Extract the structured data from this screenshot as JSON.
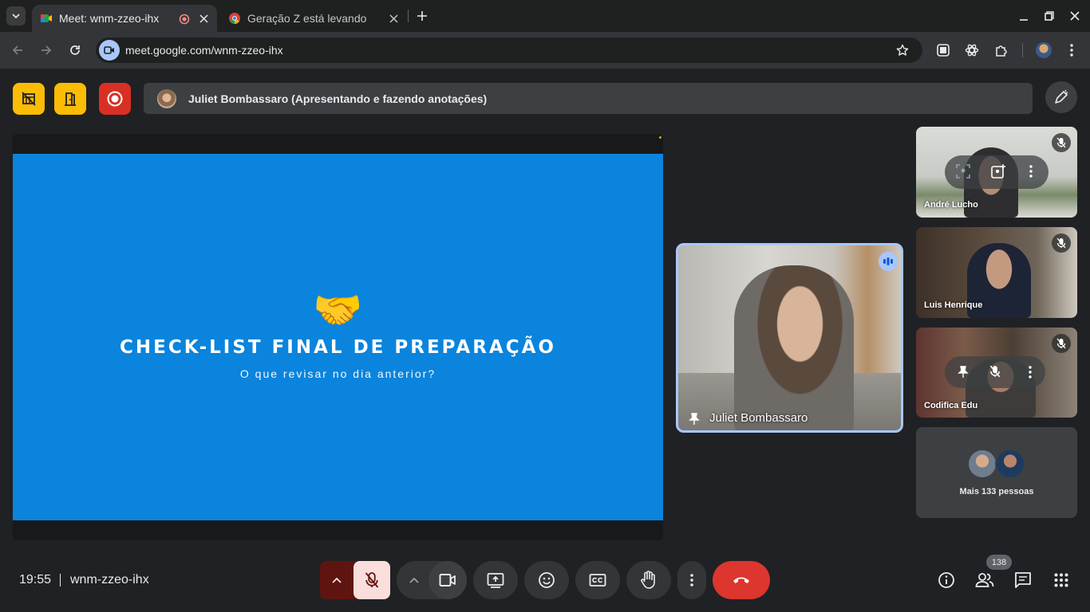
{
  "browser": {
    "tabs": [
      {
        "title": "Meet: wnm-zzeo-ihx",
        "active": true,
        "recording": true
      },
      {
        "title": "Geração Z está levando",
        "active": false
      }
    ],
    "url": "meet.google.com/wnm-zzeo-ihx"
  },
  "meeting": {
    "presenter_banner": "Juliet Bombassaro (Apresentando e fazendo anotações)",
    "slide": {
      "emoji": "🤝",
      "title": "CHECK-LIST FINAL DE PREPARAÇÃO",
      "subtitle": "O que revisar no dia anterior?"
    },
    "featured": {
      "name": "Juliet Bombassaro"
    },
    "participants": [
      {
        "name": "André Lucho",
        "muted": true
      },
      {
        "name": "Luis Henrique",
        "muted": true
      },
      {
        "name": "Codifica Edu",
        "muted": true
      }
    ],
    "more_people": "Mais 133 pessoas",
    "clock": "19:55",
    "code": "wnm-zzeo-ihx",
    "people_count": "138"
  },
  "colors": {
    "accent_yellow": "#fbbc04",
    "record_red": "#d93025",
    "slide_blue": "#0a84dc",
    "hangup_red": "#dc362e",
    "mic_off_bg": "#f9dedc",
    "speaker_border": "#a8c7fa"
  },
  "icons": [
    "dropdown-icon",
    "meet-icon",
    "record-dot-icon",
    "chrome-icon",
    "close-icon",
    "plus-icon",
    "minimize-icon",
    "restore-icon",
    "back-icon",
    "forward-icon",
    "reload-icon",
    "video-icon",
    "star-icon",
    "extensions-icon",
    "menu-icon",
    "cover-icon",
    "door-icon",
    "record-icon",
    "pen-icon",
    "speaking-icon",
    "pin-icon",
    "mic-off-icon",
    "chevron-up-icon",
    "camera-icon",
    "present-icon",
    "emoji-icon",
    "captions-icon",
    "hand-icon",
    "more-icon",
    "hangup-icon",
    "info-icon",
    "people-icon",
    "chat-icon",
    "activities-icon"
  ]
}
